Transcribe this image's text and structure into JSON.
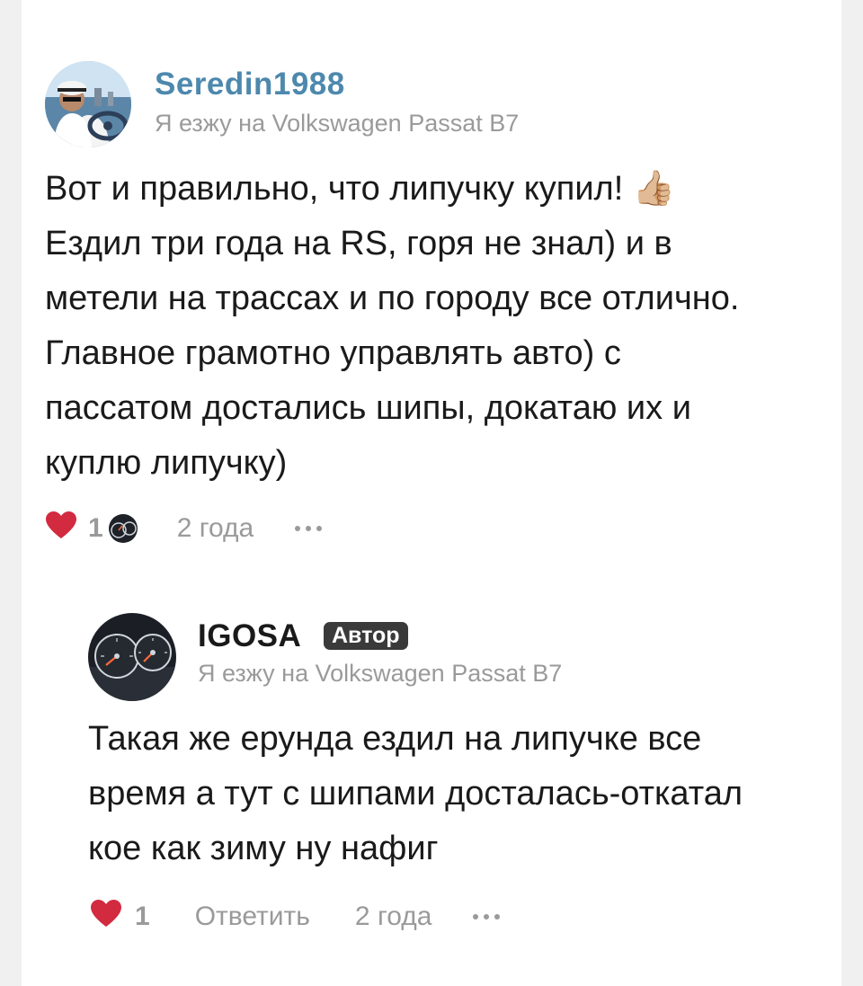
{
  "comments": [
    {
      "author": "Seredin1988",
      "car": "Я езжу на Volkswagen Passat B7",
      "text_lines": [
        "Вот и правильно, что липучку купил! 👍🏼",
        "Ездил три года на RS, горя не знал) и в",
        "метели на трассах и по городу все отлично.",
        "Главное грамотно управлять авто) с",
        "пассатом достались шипы, докатаю их и",
        "куплю липучку)"
      ],
      "likes": "1",
      "time": "2 года",
      "author_color": "#4d88ad"
    },
    {
      "author": "IGOSA",
      "badge": "Автор",
      "car": "Я езжу на Volkswagen Passat B7",
      "text_lines": [
        "Такая же ерунда ездил на липучке все",
        "время а тут с шипами досталась-откатал",
        "кое как зиму ну нафиг"
      ],
      "likes": "1",
      "reply": "Ответить",
      "time": "2 года",
      "author_color": "#1a1a1a"
    }
  ],
  "colors": {
    "heart": "#d22a3f",
    "meta_text": "#9a9a9a",
    "badge_bg": "#3a3a3a"
  }
}
